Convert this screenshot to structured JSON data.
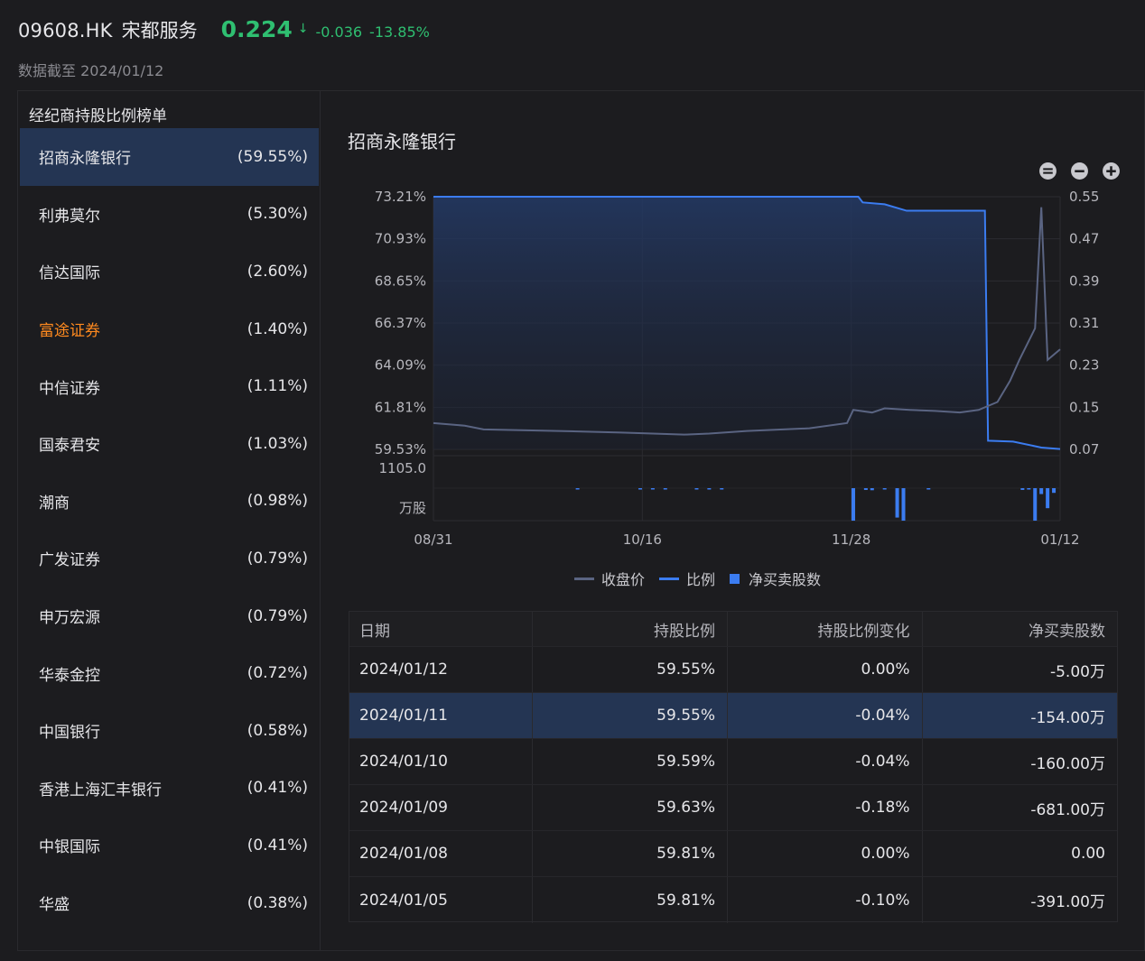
{
  "header": {
    "symbol": "09608.HK",
    "name": "宋都服务",
    "price": "0.224",
    "arrow": "↓",
    "change": "-0.036",
    "change_pct": "-13.85%",
    "as_of": "数据截至 2024/01/12",
    "up_down_color": "#2fbf71"
  },
  "sidebar": {
    "title": "经纪商持股比例榜单",
    "items": [
      {
        "name": "招商永隆银行",
        "pct": "(59.55%)",
        "active": true
      },
      {
        "name": "利弗莫尔",
        "pct": "(5.30%)"
      },
      {
        "name": "信达国际",
        "pct": "(2.60%)"
      },
      {
        "name": "富途证券",
        "pct": "(1.40%)",
        "highlight": true
      },
      {
        "name": "中信证券",
        "pct": "(1.11%)"
      },
      {
        "name": "国泰君安",
        "pct": "(1.03%)"
      },
      {
        "name": "潮商",
        "pct": "(0.98%)"
      },
      {
        "name": "广发证券",
        "pct": "(0.79%)"
      },
      {
        "name": "申万宏源",
        "pct": "(0.79%)"
      },
      {
        "name": "华泰金控",
        "pct": "(0.72%)"
      },
      {
        "name": "中国银行",
        "pct": "(0.58%)"
      },
      {
        "name": "香港上海汇丰银行",
        "pct": "(0.41%)"
      },
      {
        "name": "中银国际",
        "pct": "(0.41%)"
      },
      {
        "name": "华盛",
        "pct": "(0.38%)"
      }
    ]
  },
  "chart": {
    "title": "招商永隆银行",
    "zoom_icons": [
      "zoom-reset-icon",
      "zoom-out-icon",
      "zoom-in-icon"
    ],
    "legend": [
      "收盘价",
      "比例",
      "净买卖股数"
    ],
    "volume_top_label": "1105.0",
    "volume_unit": "万股",
    "colors": {
      "price": "#5a6482",
      "ratio": "#3b7cf0",
      "volume": "#3b7cf0"
    }
  },
  "chart_data": {
    "type": "line",
    "x_ticks": [
      "08/31",
      "10/16",
      "11/28",
      "01/12"
    ],
    "y_left_ticks": [
      "73.21%",
      "70.93%",
      "68.65%",
      "66.37%",
      "64.09%",
      "61.81%",
      "59.53%"
    ],
    "y_right_ticks": [
      "0.55",
      "0.47",
      "0.39",
      "0.31",
      "0.23",
      "0.15",
      "0.07"
    ],
    "y_left_range": [
      59.53,
      73.21
    ],
    "y_right_range": [
      0.07,
      0.55
    ],
    "series": [
      {
        "name": "比例",
        "axis": "left",
        "x": [
          0,
          0.23,
          0.5,
          0.678,
          0.685,
          0.72,
          0.755,
          0.88,
          0.885,
          0.925,
          0.97,
          1
        ],
        "values": [
          73.21,
          73.21,
          73.21,
          73.21,
          72.9,
          72.8,
          72.45,
          72.45,
          60.0,
          59.95,
          59.63,
          59.55
        ]
      },
      {
        "name": "收盘价",
        "axis": "right",
        "x": [
          0,
          0.05,
          0.08,
          0.2,
          0.3,
          0.4,
          0.44,
          0.5,
          0.6,
          0.66,
          0.67,
          0.7,
          0.72,
          0.76,
          0.8,
          0.84,
          0.87,
          0.9,
          0.92,
          0.935,
          0.96,
          0.97,
          0.98,
          0.99,
          1
        ],
        "values": [
          0.12,
          0.115,
          0.108,
          0.105,
          0.102,
          0.098,
          0.1,
          0.105,
          0.11,
          0.12,
          0.145,
          0.14,
          0.148,
          0.145,
          0.143,
          0.14,
          0.145,
          0.16,
          0.2,
          0.24,
          0.3,
          0.53,
          0.24,
          0.25,
          0.26
        ]
      }
    ],
    "volume_bars": {
      "name": "净买卖股数",
      "x": [
        0.23,
        0.33,
        0.35,
        0.37,
        0.42,
        0.44,
        0.46,
        0.67,
        0.69,
        0.7,
        0.72,
        0.74,
        0.75,
        0.79,
        0.94,
        0.95,
        0.96,
        0.97,
        0.98,
        0.99
      ],
      "values": [
        -30,
        -40,
        -40,
        -30,
        -30,
        -30,
        -30,
        -1105,
        -60,
        -70,
        -40,
        -1000,
        -1105,
        -20,
        -60,
        -30,
        -1105,
        -200,
        -681,
        -160
      ]
    }
  },
  "table": {
    "headers": [
      "日期",
      "持股比例",
      "持股比例变化",
      "净买卖股数"
    ],
    "rows": [
      {
        "date": "2024/01/12",
        "ratio": "59.55%",
        "change": "0.00%",
        "net": "-5.00万"
      },
      {
        "date": "2024/01/11",
        "ratio": "59.55%",
        "change": "-0.04%",
        "net": "-154.00万",
        "active": true
      },
      {
        "date": "2024/01/10",
        "ratio": "59.59%",
        "change": "-0.04%",
        "net": "-160.00万"
      },
      {
        "date": "2024/01/09",
        "ratio": "59.63%",
        "change": "-0.18%",
        "net": "-681.00万"
      },
      {
        "date": "2024/01/08",
        "ratio": "59.81%",
        "change": "0.00%",
        "net": "0.00"
      },
      {
        "date": "2024/01/05",
        "ratio": "59.81%",
        "change": "-0.10%",
        "net": "-391.00万"
      }
    ]
  }
}
